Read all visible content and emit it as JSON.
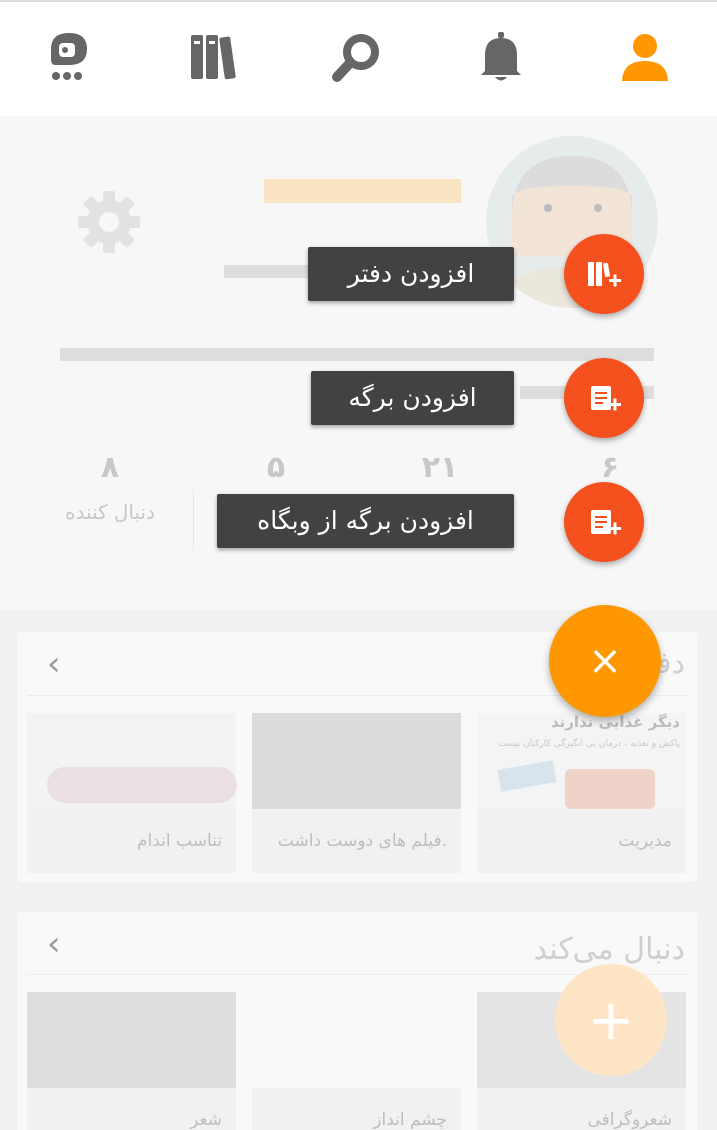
{
  "colors": {
    "accent": "#ff9800",
    "fab_action": "#f4511e",
    "chip_bg": "#424242",
    "nav_icon": "#666666",
    "nav_active": "#ff9800"
  },
  "nav": {
    "items": [
      {
        "name": "profile",
        "icon": "person-icon",
        "active": true
      },
      {
        "name": "notifications",
        "icon": "bell-icon",
        "active": false
      },
      {
        "name": "search",
        "icon": "search-icon",
        "active": false
      },
      {
        "name": "library",
        "icon": "books-icon",
        "active": false
      },
      {
        "name": "more",
        "icon": "bot-chat-icon",
        "active": false
      }
    ]
  },
  "profile": {
    "stats": [
      {
        "value": "۶",
        "label": ""
      },
      {
        "value": "۲۱",
        "label": ""
      },
      {
        "value": "۵",
        "label": ""
      },
      {
        "value": "۸",
        "label": "دنبال کننده"
      }
    ]
  },
  "speed_dial": {
    "actions": [
      {
        "label": "افزودن دفتر",
        "icon": "add-notebook-icon"
      },
      {
        "label": "افزودن برگه",
        "icon": "add-page-icon"
      },
      {
        "label": "افزودن برگه از وبگاه",
        "icon": "add-web-page-icon"
      }
    ],
    "main_symbol": "×"
  },
  "sections": [
    {
      "title": "دفـ",
      "chevron": "‹",
      "tiles": [
        {
          "caption": "مدیریت",
          "banner_text": "دیگر غذایی ندارند",
          "sub_text": "پاکش و تغذیه ، درمان بی انگیزگی کارکنان نیست"
        },
        {
          "caption": "فیلم های دوست داشت."
        },
        {
          "caption": "تناسب اندام"
        }
      ]
    },
    {
      "title": "دنبال می‌کند",
      "chevron": "‹",
      "tiles": [
        {
          "caption": "شعروگرافی"
        },
        {
          "caption": "چشم انداز"
        },
        {
          "caption": "شعر"
        }
      ]
    }
  ],
  "bottom_fab_symbol": "+"
}
